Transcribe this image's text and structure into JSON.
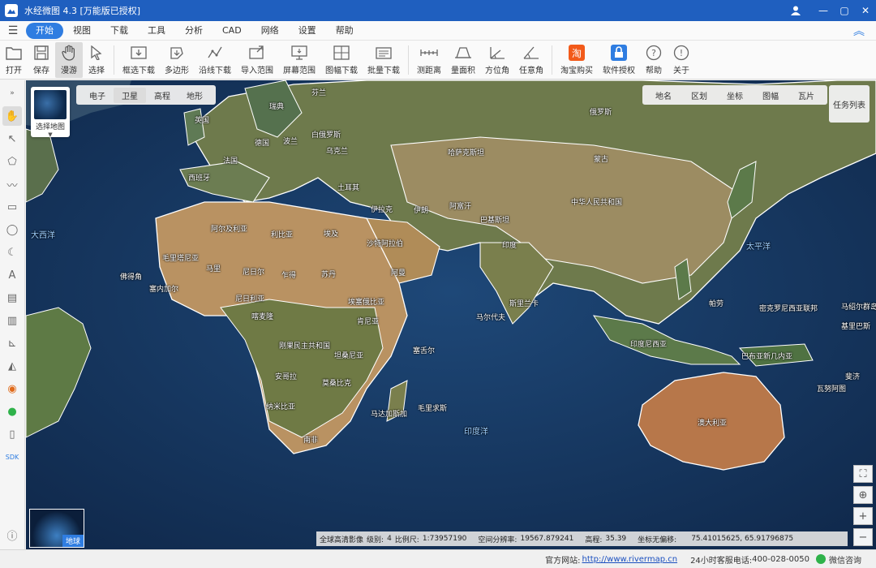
{
  "window": {
    "title": "水经微图 4.3 [万能版已授权]"
  },
  "menu": {
    "items": [
      "开始",
      "视图",
      "下载",
      "工具",
      "分析",
      "CAD",
      "网络",
      "设置",
      "帮助"
    ]
  },
  "toolbar": {
    "open": "打开",
    "save": "保存",
    "pan": "漫游",
    "select": "选择",
    "box_download": "框选下载",
    "polygon": "多边形",
    "line_download": "沿线下载",
    "import_range": "导入范围",
    "screen_range": "屏幕范围",
    "sheet_download": "图幅下载",
    "batch_download": "批量下载",
    "measure_distance": "测距离",
    "measure_area": "量面积",
    "azimuth": "方位角",
    "any_angle": "任意角",
    "taobao": "淘宝购买",
    "license": "软件授权",
    "help": "帮助",
    "about": "关于"
  },
  "map": {
    "select_map_label": "选择地图",
    "layer_tabs": [
      "电子",
      "卫星",
      "高程",
      "地形"
    ],
    "overlay_tabs": [
      "地名",
      "区划",
      "坐标",
      "图幅",
      "瓦片"
    ],
    "task_list": "任务列表",
    "globe_label": "地球",
    "labels": {
      "russia": "俄罗斯",
      "uk": "英国",
      "finland": "芬兰",
      "kazakhstan": "哈萨克斯坦",
      "mongolia": "蒙古",
      "china": "中华人民共和国",
      "india": "印度",
      "iran": "伊朗",
      "afghanistan": "阿富汗",
      "saudi": "沙特阿拉伯",
      "algeria": "阿尔及利亚",
      "libya": "利比亚",
      "egypt": "埃及",
      "mauritania": "毛里塔尼亚",
      "mali": "马里",
      "niger": "尼日尔",
      "chad": "乍得",
      "sudan": "苏丹",
      "nigeria": "尼日利亚",
      "ethiopia": "埃塞俄比亚",
      "drc": "刚果民主共和国",
      "tanzania": "坦桑尼亚",
      "angola": "安哥拉",
      "mozambique": "莫桑比克",
      "madagascar": "马达加斯加",
      "namibia": "纳米比亚",
      "south_africa": "南非",
      "australia": "澳大利亚",
      "indonesia": "印度尼西亚",
      "png": "巴布亚新几内亚",
      "ocean_atlantic": "大西洋",
      "ocean_pacific": "太平洋",
      "ocean_indian": "印度洋",
      "mauritius": "毛里求斯",
      "seychelles": "塞舌尔",
      "maldives": "马尔代夫",
      "sri_lanka": "斯里兰卡",
      "france": "法国",
      "poland": "波兰",
      "ukraine": "乌克兰",
      "turkey": "土耳其",
      "spain": "西班牙",
      "germany": "德国",
      "kenya": "肯尼亚",
      "cape_verde": "佛得角",
      "marshall": "马绍尔群岛",
      "palau": "帕劳",
      "micronesia": "密克罗尼西亚联邦",
      "kiribati": "基里巴斯",
      "vanuatu": "瓦努阿图",
      "fiji": "斐济",
      "pakistan": "巴基斯坦",
      "oman": "阿曼",
      "belarus": "白俄罗斯",
      "sweden": "瑞典",
      "iraq": "伊拉克",
      "senegal": "塞内加尔",
      "cameroon": "喀麦隆"
    }
  },
  "status": {
    "source": "全球高清影像",
    "level_label": "级别:",
    "level": "4",
    "scale_label": "比例尺:",
    "scale": "1:73957190",
    "resolution_label": "空间分辨率:",
    "resolution": "19567.879241",
    "elevation_label": "高程:",
    "elevation": "35.39",
    "coord_label": "坐标无偏移:",
    "coord": "75.41015625, 65.91796875"
  },
  "footer": {
    "website_label": "官方网站:",
    "website": "http://www.rivermap.cn",
    "hotline_label": "24小时客服电话:",
    "hotline": "400-028-0050",
    "wechat": "微信咨询"
  },
  "colors": {
    "titlebar": "#1f5fbf",
    "accent": "#2f7de1",
    "ocean": "#17355f",
    "land": "#a1844f",
    "border": "#ffffff"
  }
}
